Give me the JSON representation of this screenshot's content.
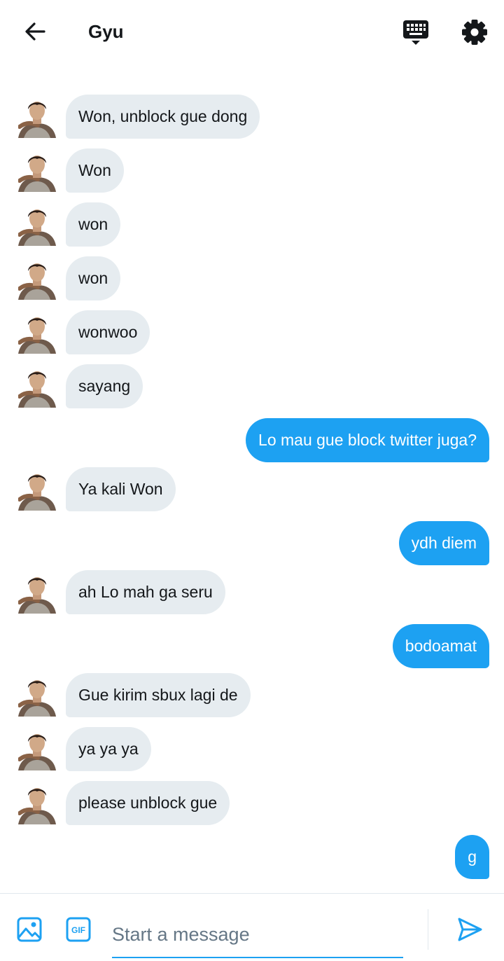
{
  "header": {
    "title": "Gyu",
    "back_icon": "arrow-left-icon",
    "keyboard_icon": "keyboard-icon",
    "settings_icon": "gear-icon"
  },
  "colors": {
    "accent": "#1da1f2",
    "incoming_bubble": "#e6ecf0",
    "text": "#14171a",
    "placeholder": "#657786"
  },
  "messages": [
    {
      "direction": "in",
      "text": "Won, unblock gue dong"
    },
    {
      "direction": "in",
      "text": "Won"
    },
    {
      "direction": "in",
      "text": "won"
    },
    {
      "direction": "in",
      "text": "won"
    },
    {
      "direction": "in",
      "text": "wonwoo"
    },
    {
      "direction": "in",
      "text": "sayang"
    },
    {
      "direction": "out",
      "text": "Lo mau gue block twitter juga?"
    },
    {
      "direction": "in",
      "text": "Ya kali Won"
    },
    {
      "direction": "out",
      "text": "ydh diem"
    },
    {
      "direction": "in",
      "text": "ah Lo mah ga seru"
    },
    {
      "direction": "out",
      "text": "bodoamat"
    },
    {
      "direction": "in",
      "text": "Gue kirim sbux lagi de"
    },
    {
      "direction": "in",
      "text": "ya ya ya"
    },
    {
      "direction": "in",
      "text": "please unblock gue"
    },
    {
      "direction": "out",
      "text": "g"
    }
  ],
  "composer": {
    "placeholder": "Start a message",
    "value": "",
    "image_icon": "image-icon",
    "gif_icon": "gif-icon",
    "gif_label": "GIF",
    "send_icon": "send-icon"
  }
}
